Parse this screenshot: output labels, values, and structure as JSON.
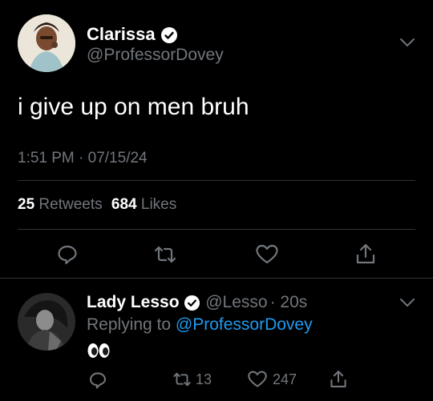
{
  "main_tweet": {
    "author": {
      "display_name": "Clarissa",
      "handle": "@ProfessorDovey",
      "verified": true,
      "avatar_icon": "portrait-avatar"
    },
    "text": "i give up on men bruh",
    "timestamp": "1:51 PM · 07/15/24",
    "stats": {
      "retweets_count": "25",
      "retweets_label": "Retweets",
      "likes_count": "684",
      "likes_label": "Likes"
    },
    "actions": [
      "reply-icon",
      "retweet-icon",
      "like-icon",
      "share-icon"
    ]
  },
  "reply_tweet": {
    "author": {
      "display_name": "Lady Lesso",
      "handle": "@Lesso",
      "time": "· 20s",
      "verified": true,
      "avatar_icon": "portrait-avatar-bw"
    },
    "replying_to_label": "Replying to",
    "replying_to_handle": "@ProfessorDovey",
    "text": "👀",
    "actions": {
      "retweets": "13",
      "likes": "247"
    }
  },
  "colors": {
    "background": "#000000",
    "text": "#e7e9ea",
    "muted": "#71767b",
    "accent": "#1d9bf0",
    "divider": "#2f3336"
  }
}
